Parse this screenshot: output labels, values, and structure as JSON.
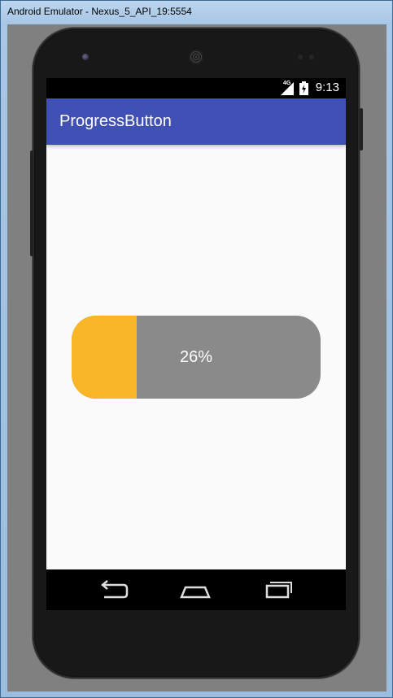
{
  "window": {
    "title": "Android Emulator - Nexus_5_API_19:5554"
  },
  "status_bar": {
    "network": "4G",
    "time": "9:13"
  },
  "app_bar": {
    "title": "ProgressButton"
  },
  "progress_button": {
    "label": "26%",
    "progress_fraction": 0.26,
    "fill_color": "#fbb627",
    "track_color": "#8a8a8a"
  },
  "navigation": {
    "back_icon": "back-arrow-icon",
    "home_icon": "home-icon",
    "recents_icon": "recents-icon"
  },
  "colors": {
    "app_bar": "#3f51b5",
    "screen_background": "#fafafa"
  }
}
